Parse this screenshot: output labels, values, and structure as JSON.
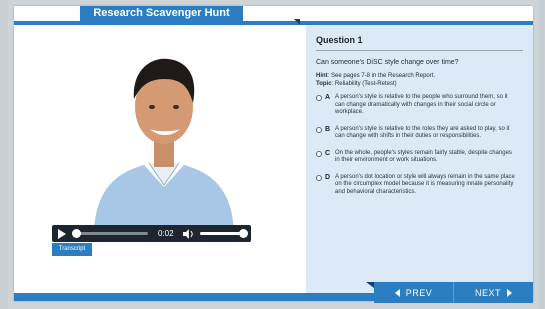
{
  "app": {
    "title": "Research Scavenger Hunt"
  },
  "video": {
    "time": "0:02",
    "transcript_label": "Transcript",
    "play_icon": "play-icon",
    "volume_icon": "volume-icon"
  },
  "question": {
    "title": "Question 1",
    "text": "Can someone's DiSC style change over time?",
    "hint_label": "Hint",
    "hint_text": ": See pages 7-8 in the Research Report.",
    "topic_label": "Topic",
    "topic_text": ": Reliability (Test-Retest)",
    "options": [
      {
        "letter": "A",
        "text": "A person's style is relative to the people who surround them, so it can change dramatically with changes in their social circle or workplace."
      },
      {
        "letter": "B",
        "text": "A person's style is relative to the roles they are asked to play, so it can change with shifts in their duties or responsibilities."
      },
      {
        "letter": "C",
        "text": "On the whole, people's styles remain fairly stable, despite changes in their environment or work situations."
      },
      {
        "letter": "D",
        "text": "A person's dot location or style will always remain in the same place on the circumplex model because it is measuring innate personality and behavioral characteristics."
      }
    ]
  },
  "nav": {
    "prev_label": "PREV",
    "next_label": "NEXT"
  },
  "colors": {
    "accent": "#2b7ec2",
    "panel": "#dbeaf6",
    "player": "#1d2630"
  }
}
